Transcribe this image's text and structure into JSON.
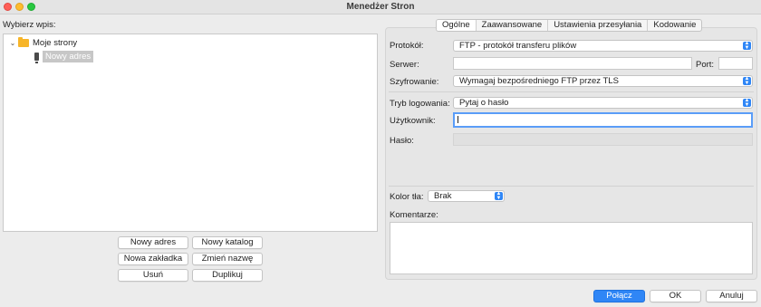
{
  "window": {
    "title": "Menedżer Stron"
  },
  "left": {
    "label": "Wybierz wpis:",
    "tree": {
      "folder": "Moje strony",
      "site": "Nowy adres"
    },
    "buttons": {
      "new_site": "Nowy adres",
      "new_folder": "Nowy katalog",
      "new_bookmark": "Nowa zakładka",
      "rename": "Zmień nazwę",
      "delete": "Usuń",
      "duplicate": "Duplikuj"
    }
  },
  "tabs": [
    "Ogólne",
    "Zaawansowane",
    "Ustawienia przesyłania",
    "Kodowanie"
  ],
  "general": {
    "protocol_label": "Protokół:",
    "protocol_value": "FTP - protokół transferu plików",
    "server_label": "Serwer:",
    "server_value": "",
    "port_label": "Port:",
    "port_value": "",
    "encryption_label": "Szyfrowanie:",
    "encryption_value": "Wymagaj bezpośredniego FTP przez TLS",
    "logon_label": "Tryb logowania:",
    "logon_value": "Pytaj o hasło",
    "user_label": "Użytkownik:",
    "user_value": "",
    "password_label": "Hasło:",
    "password_value": "",
    "bgcolor_label": "Kolor tła:",
    "bgcolor_value": "Brak",
    "comments_label": "Komentarze:",
    "comments_value": ""
  },
  "footer": {
    "connect": "Połącz",
    "ok": "OK",
    "cancel": "Anuluj"
  },
  "colors": {
    "accent": "#2f86f6",
    "folder": "#f7b529",
    "traffic_red": "#ff5f57",
    "traffic_yellow": "#febc2e",
    "traffic_green": "#28c840"
  }
}
